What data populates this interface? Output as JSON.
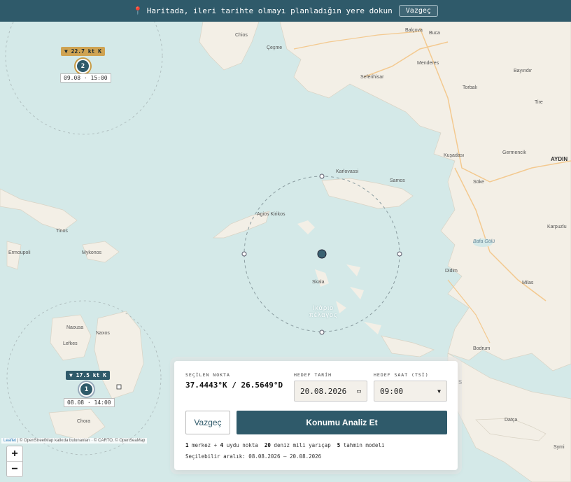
{
  "banner": {
    "pin_icon": "map-pin-icon",
    "message": "Haritada, ileri tarihte olmayı planladığın yere dokun",
    "cancel_label": "Vazgeç"
  },
  "places": [
    {
      "name": "Chios"
    },
    {
      "name": "Çeşme"
    },
    {
      "name": "Balçova"
    },
    {
      "name": "Buca"
    },
    {
      "name": "Menderes"
    },
    {
      "name": "Seferihisar"
    },
    {
      "name": "Bayındır"
    },
    {
      "name": "Torbalı"
    },
    {
      "name": "Tire"
    },
    {
      "name": "Kuşadası"
    },
    {
      "name": "Germencik"
    },
    {
      "name": "AYDIN"
    },
    {
      "name": "Karlovassi"
    },
    {
      "name": "Samos"
    },
    {
      "name": "Söke"
    },
    {
      "name": "Karpuzlu"
    },
    {
      "name": "Bafa Gölü"
    },
    {
      "name": "Agios Kirikos"
    },
    {
      "name": "Tinos"
    },
    {
      "name": "Ermoupoli"
    },
    {
      "name": "Mykonos"
    },
    {
      "name": "Didim"
    },
    {
      "name": "Milas"
    },
    {
      "name": "Skala"
    },
    {
      "name": "Naousa"
    },
    {
      "name": "Naxos"
    },
    {
      "name": "Lefkes"
    },
    {
      "name": "Chora"
    },
    {
      "name": "Bodrum"
    },
    {
      "name": "Datça"
    },
    {
      "name": "Symi"
    },
    {
      "name": "S"
    }
  ],
  "sea_label": "Ικάριο πέλαγος",
  "markers": [
    {
      "number": "2",
      "wind": "22.7 kt K",
      "time": "09.08 · 15:00"
    },
    {
      "number": "1",
      "wind": "17.5 kt K",
      "time": "08.08 · 14:00"
    }
  ],
  "attribution": {
    "leaflet": "Leaflet",
    "rest": " | © OpenStreetMap katkıda bulunanları · © CARTO, © OpenSeaMap"
  },
  "zoom": {
    "in": "+",
    "out": "−"
  },
  "panel": {
    "selected_label": "SEÇİLEN NOKTA",
    "coords": "37.4443°K / 26.5649°D",
    "date_label": "HEDEF TARİH",
    "date_value": "20.08.2026",
    "time_label": "HEDEF SAAT (TSİ)",
    "time_value": "09:00",
    "cancel_label": "Vazgeç",
    "analyze_label": "Konumu Analiz Et",
    "stats": {
      "center": "1",
      "t1": " merkez + ",
      "sat": "4",
      "t2": " uydu nokta  ",
      "radius": "20",
      "t3": " deniz mili yarıçap  ",
      "models": "5",
      "t4": " tahmin modeli"
    },
    "range": "Seçilebilir aralık: 08.08.2026 – 20.08.2026"
  },
  "colors": {
    "accent": "#2f5a6a",
    "gold": "#cfa352",
    "sea": "#d4e9e8",
    "land": "#f3efe6",
    "roads": "#f3c98f"
  }
}
